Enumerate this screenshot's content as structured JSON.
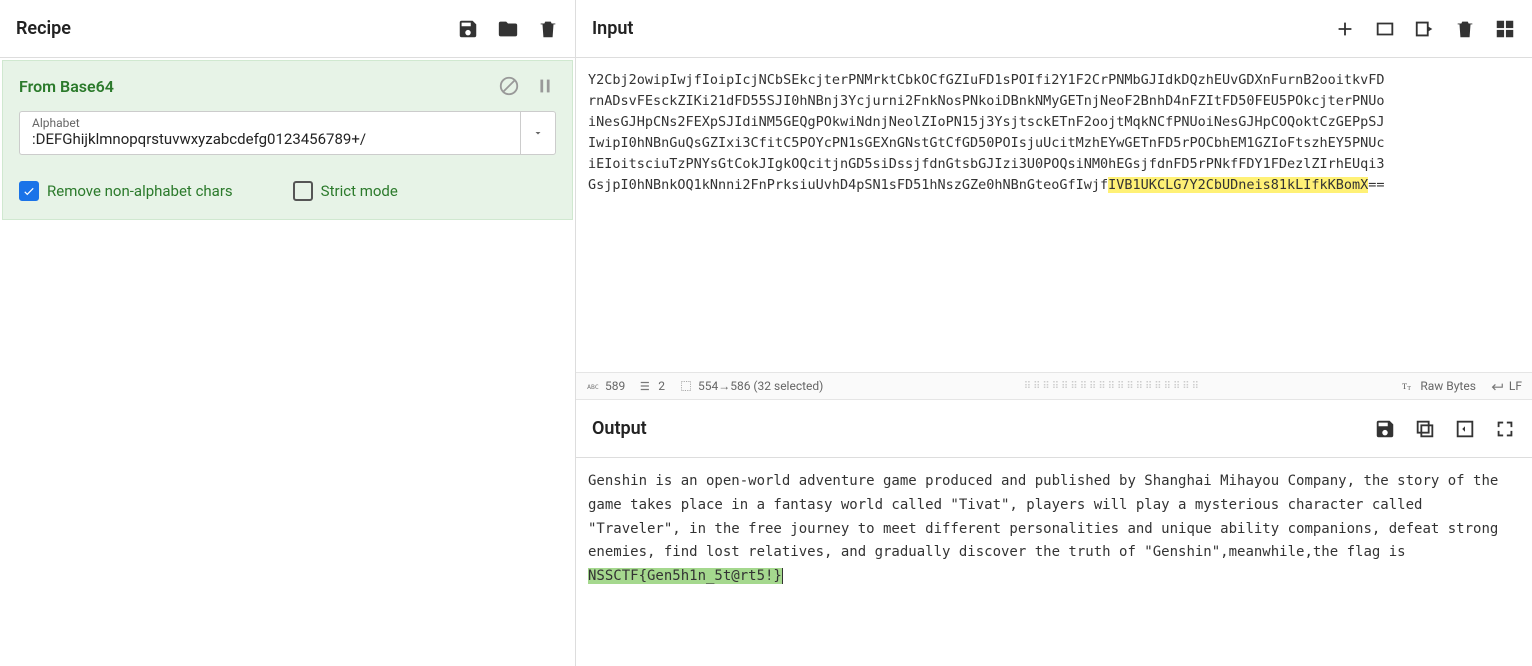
{
  "recipe": {
    "title": "Recipe",
    "operation": {
      "name": "From Base64",
      "alphabet_label": "Alphabet",
      "alphabet_value": ":DEFGhijklmnopqrstuvwxyzabcdefg0123456789+/",
      "remove_non_alpha_label": "Remove non-alphabet chars",
      "remove_non_alpha_checked": true,
      "strict_mode_label": "Strict mode",
      "strict_mode_checked": false
    }
  },
  "input": {
    "title": "Input",
    "text_lines": [
      "Y2Cbj2owipIwjfIoipIcjNCbSEkcjterPNMrktCbkOCfGZIuFD1sPOIfi2Y1F2CrPNMbGJIdkDQzhEUvGDXnFurnB2ooitkvFD",
      "rnADsvFEsckZIKi21dFD55SJI0hNBnj3Ycjurni2FnkNosPNkoiDBnkNMyGETnjNeoF2BnhD4nFZItFD50FEU5POkcjterPNUo",
      "iNesGJHpCNs2FEXpSJIdiNM5GEQgPOkwiNdnjNeolZIoPN15j3YsjtsckETnF2oojtMqkNCfPNUoiNesGJHpCOQoktCzGEPpSJ",
      "IwipI0hNBnGuQsGZIxi3CfitC5POYcPN1sGEXnGNstGtCfGD50POIsjuUcitMzhEYwGETnFD5rPOCbhEM1GZIoFtszhEY5PNUc",
      "iEIoitsciuTzPNYsGtCokJIgkOQcitjnGD5siDssjfdnGtsbGJIzi3U0POQsiNM0hEGsjfdnFD5rPNkfFDY1FDezlZIrhEUqi3",
      "GsjpI0hNBnkOQ1kNnni2FnPrksiuUvhD4pSN1sFD51hNszGZe0hNBnGteoGfIwjf"
    ],
    "highlighted_segment": "IVB1UKCLG7Y2CbUDneis81kLIfkKBomX",
    "trailing": "=="
  },
  "status": {
    "char_count": "589",
    "line_count": "2",
    "selection": "554→586 (32 selected)",
    "encoding_label": "Raw Bytes",
    "eol_label": "LF"
  },
  "output": {
    "title": "Output",
    "text_before": "Genshin is an open-world adventure game produced and published by Shanghai Mihayou Company, the story of the game takes place in a fantasy world called \"Tivat\", players will play a mysterious character called \"Traveler\", in the free journey to meet different personalities and unique ability companions, defeat strong enemies, find lost relatives, and gradually discover the truth of \"Genshin\",meanwhile,the flag is ",
    "highlighted_flag": "NSSCTF{Gen5h1n_5t@rt5!}"
  }
}
